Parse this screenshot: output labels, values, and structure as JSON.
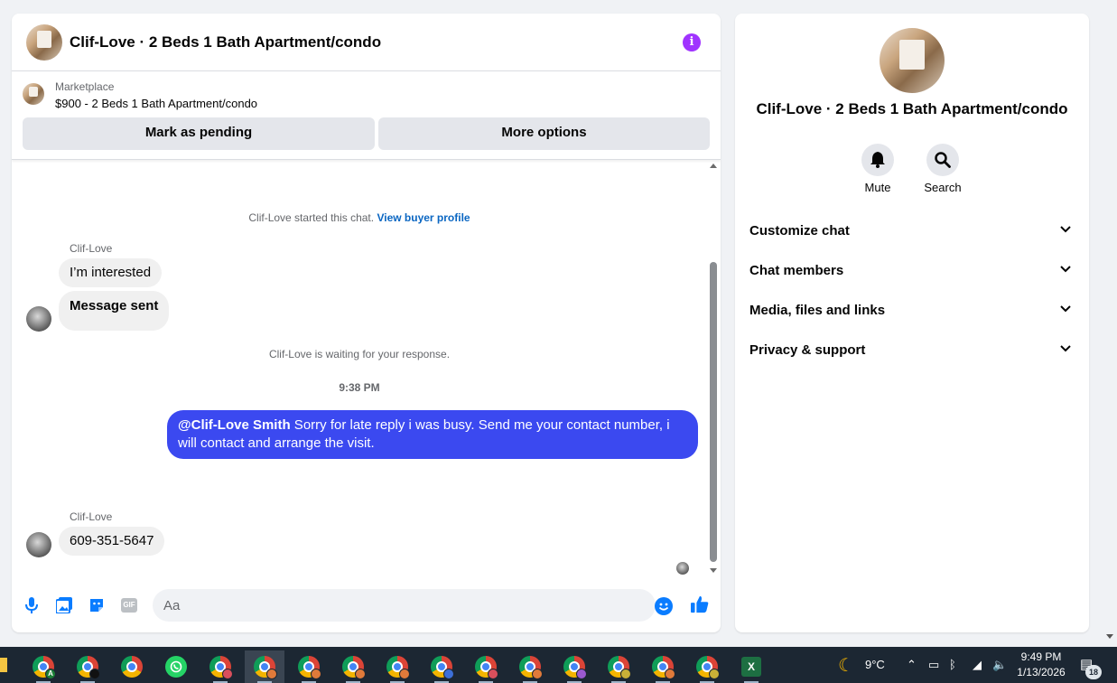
{
  "chat": {
    "title": "Clif-Love · 2 Beds 1 Bath Apartment/condo",
    "info_icon": "i",
    "listing": {
      "source": "Marketplace",
      "name": "$900 - 2 Beds 1 Bath Apartment/condo",
      "mark_pending_label": "Mark as pending",
      "more_options_label": "More options"
    },
    "messages": {
      "started_text": "Clif-Love started this chat.",
      "view_profile_link": "View buyer profile",
      "sender_1": "Clif-Love",
      "bubble_1": "I’m interested",
      "bubble_2": "Message sent",
      "waiting_text": "Clif-Love is waiting for your response.",
      "timestamp": "9:38 PM",
      "out_mention": "@Clif-Love Smith",
      "out_text": " Sorry for late reply i was busy. Send me your contact number, i will contact and arrange the visit.",
      "sender_2": "Clif-Love",
      "bubble_3": "609-351-5647"
    },
    "composer": {
      "placeholder": "Aa",
      "gif_label": "GIF"
    }
  },
  "side_panel": {
    "title": "Clif-Love · 2 Beds 1 Bath Apartment/condo",
    "actions": [
      {
        "label": "Mute",
        "icon": "bell-icon"
      },
      {
        "label": "Search",
        "icon": "search-icon"
      }
    ],
    "sections": [
      {
        "label": "Customize chat"
      },
      {
        "label": "Chat members"
      },
      {
        "label": "Media, files and links"
      },
      {
        "label": "Privacy & support"
      }
    ]
  },
  "taskbar": {
    "temperature": "9°C",
    "time": "9:49 PM",
    "date": "1/13/2026",
    "notification_count": "18",
    "badge_a": "A"
  },
  "colors": {
    "accent_blue": "#3b49f0",
    "messenger_blue": "#0a7cff",
    "info_purple": "#a033ff",
    "link_blue": "#0a66c2"
  }
}
